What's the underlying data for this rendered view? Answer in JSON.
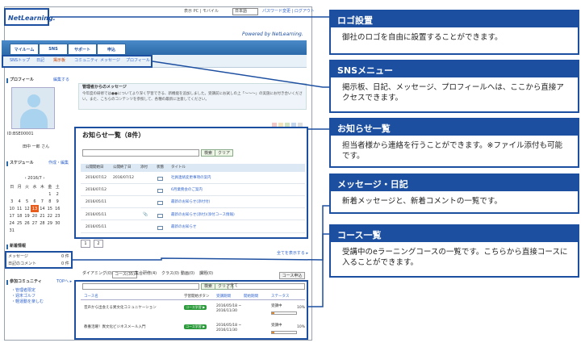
{
  "screen": {
    "logo_text": "NetLearning.",
    "top_links": "表示 PC | モバイル",
    "language": "日本語",
    "top_links_right": "パスワード変更 | ログアウト",
    "powered_by": "Powered by NetLearning.",
    "tabs": [
      {
        "label": "マイルーム"
      },
      {
        "label": "SNS"
      },
      {
        "label": "サポート"
      },
      {
        "label": "申込"
      }
    ],
    "subnav": [
      {
        "label": "SNSトップ"
      },
      {
        "label": "日記"
      },
      {
        "label": "掲示板"
      },
      {
        "label": "コミュニティ"
      },
      {
        "label": "メッセージ"
      },
      {
        "label": "プロフィール"
      }
    ],
    "sidebar": {
      "profile_heading": "プロフィール",
      "profile_edit": "編集する",
      "user_id": "ID:BSE00001",
      "user_name": "田中 一郎 さん",
      "schedule_heading": "スケジュール",
      "schedule_edit": "作成・編集",
      "month_label": "2016/7",
      "weekdays": [
        "日",
        "月",
        "火",
        "水",
        "木",
        "金",
        "土"
      ],
      "weeks": [
        [
          "",
          "",
          "",
          "",
          "",
          "1",
          "2"
        ],
        [
          "3",
          "4",
          "5",
          "6",
          "7",
          "8",
          "9"
        ],
        [
          "10",
          "11",
          "12",
          "13",
          "14",
          "15",
          "16"
        ],
        [
          "17",
          "18",
          "19",
          "20",
          "21",
          "22",
          "23"
        ],
        [
          "24",
          "25",
          "26",
          "27",
          "28",
          "29",
          "30"
        ],
        [
          "31",
          "",
          "",
          "",
          "",
          "",
          ""
        ]
      ],
      "today": "13",
      "new_info_heading": "新着情報",
      "new_message_label": "メッセージ",
      "new_message_count": "0 件",
      "new_comment_label": "日記のコメント",
      "new_comment_count": "0 件",
      "community_heading": "参加コミュニティ",
      "community_more": "TOPへ ▸",
      "community_items": [
        "・管理者限定",
        "・週末ゴルフ",
        "・軽運動を楽しむ"
      ]
    },
    "notice": {
      "title": "管理者からのメッセージ",
      "body": "今年度の研修では●●についてより深く学習できる、新機能を追加しました。受講前にお試しの上「〜〜〜」の実施にお付き合いください。また、こちらのコンテンツを参照して、各種の最新に注意してください。"
    },
    "news": {
      "title": "お知らせ一覧（8件）",
      "search_btn": "検索",
      "clear_btn": "クリア",
      "columns": [
        "公開開始日",
        "公開終了日",
        "添付",
        "状態",
        "タイトル"
      ],
      "rows": [
        {
          "start": "2016/07/12",
          "end": "2016/07/12",
          "title": "社員連絡変更事項の案内",
          "attach": false
        },
        {
          "start": "2016/07/12",
          "end": "",
          "title": "6月業務会のご案内",
          "attach": false
        },
        {
          "start": "2016/05/11",
          "end": "",
          "title": "最新のお知らせ(添付付)",
          "attach": false
        },
        {
          "start": "2016/05/11",
          "end": "",
          "title": "最新のお知らせ(添付)(添付コース情報)",
          "attach": true
        },
        {
          "start": "2016/05/11",
          "end": "",
          "title": "最新のお知らせ",
          "attach": false
        }
      ],
      "pages": [
        "1",
        "2"
      ],
      "more": "全てを表示する ▸"
    },
    "course": {
      "tabs": [
        "ダイアミング(0)",
        "コース(35)",
        "集合研修(4)",
        "クラス(0)",
        "動画(0)",
        "課題(0)"
      ],
      "apply_btn": "コース申込",
      "search_btn": "検索",
      "clear_btn": "クリア",
      "filter": "全て",
      "columns": [
        "コース名",
        "学習開始ボタン",
        "受講期間",
        "開始期間",
        "ステータス"
      ],
      "rows": [
        {
          "name": "音声から出会える異文化コミュニケーション",
          "button": "コース学習 ▶",
          "period": "2016/05/18 ~ 2016/11/30",
          "status": "受講中",
          "progress": "10%"
        },
        {
          "name": "教養活躍！異文化ビジネスメール入門",
          "button": "コース学習 ▶",
          "period": "2016/05/18 ~ 2016/11/30",
          "status": "受講中",
          "progress": "10%"
        }
      ],
      "progress_value": 0.1
    }
  },
  "callouts": [
    {
      "title": "ロゴ設置",
      "desc": "御社のロゴを自由に設置することができます。"
    },
    {
      "title": "SNSメニュー",
      "desc": "掲示板、日記、メッセージ、プロフィールへは、ここから直接アクセスできます。"
    },
    {
      "title": "お知らせ一覧",
      "desc": "担当者様から連絡を行うことができます。※ファイル添付も可能です。"
    },
    {
      "title": "メッセージ・日記",
      "desc": "新着メッセージと、新着コメントの一覧です。"
    },
    {
      "title": "コース一覧",
      "desc": "受講中のeラーニングコースの一覧です。こちらから直接コースに入ることができます。"
    }
  ],
  "colors": {
    "accent": "#1d4fa0",
    "today": "#e65d1e",
    "badge": "#2a9a3a",
    "progress": "#e7892a"
  }
}
